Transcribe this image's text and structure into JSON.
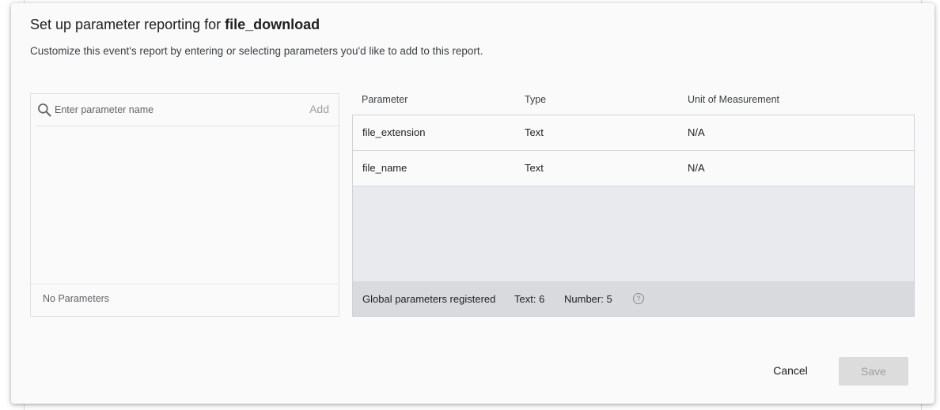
{
  "dialog": {
    "title_prefix": "Set up parameter reporting for ",
    "title_event": "file_download",
    "subtitle": "Customize this event's report by entering or selecting parameters you'd like to add to this report."
  },
  "left_panel": {
    "search_placeholder": "Enter parameter name",
    "add_label": "Add",
    "empty_text": "No Parameters"
  },
  "table": {
    "headers": [
      "Parameter",
      "Type",
      "Unit of Measurement"
    ],
    "rows": [
      {
        "parameter": "file_extension",
        "type": "Text",
        "unit": "N/A"
      },
      {
        "parameter": "file_name",
        "type": "Text",
        "unit": "N/A"
      }
    ],
    "footer": {
      "label": "Global parameters registered",
      "text_count": "Text: 6",
      "number_count": "Number: 5",
      "help_glyph": "?"
    }
  },
  "actions": {
    "cancel_label": "Cancel",
    "save_label": "Save"
  },
  "icons": {
    "search": "search-icon",
    "help": "help-icon"
  }
}
